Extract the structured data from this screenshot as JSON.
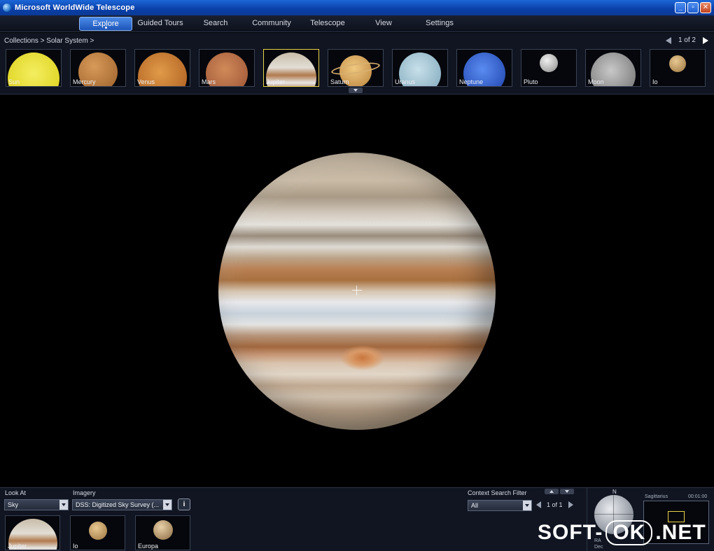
{
  "window": {
    "title": "Microsoft WorldWide Telescope",
    "buttons": {
      "minimize": "_",
      "restore": "▫",
      "close": "✕"
    }
  },
  "nav": {
    "tabs": [
      {
        "label": "Explore",
        "active": true
      },
      {
        "label": "Guided Tours",
        "active": false
      },
      {
        "label": "Search",
        "active": false
      },
      {
        "label": "Community",
        "active": false
      },
      {
        "label": "Telescope",
        "active": false
      },
      {
        "label": "View",
        "active": false
      },
      {
        "label": "Settings",
        "active": false
      }
    ]
  },
  "collections": {
    "breadcrumb": "Collections > Solar System >",
    "pager": "1 of 2",
    "items": [
      {
        "label": "Sun",
        "color": "#e8e01e"
      },
      {
        "label": "Mercury",
        "color": "#b8793a"
      },
      {
        "label": "Venus",
        "color": "#c87a2a"
      },
      {
        "label": "Mars",
        "color": "#b86a3c"
      },
      {
        "label": "Jupiter",
        "color": "#c9b8a0",
        "selected": true
      },
      {
        "label": "Saturn",
        "color": "#d8a860"
      },
      {
        "label": "Uranus",
        "color": "#a8c8d8"
      },
      {
        "label": "Neptune",
        "color": "#2a5ed0"
      },
      {
        "label": "Pluto",
        "color": "#b8b8b8"
      },
      {
        "label": "Moon",
        "color": "#9a9a9a"
      },
      {
        "label": "Io",
        "color": "#c8a878"
      }
    ]
  },
  "bottom": {
    "look_at": {
      "label": "Look At",
      "value": "Sky"
    },
    "imagery": {
      "label": "Imagery",
      "value": "DSS: Digitized Sky Survey (..."
    },
    "info_button": "i",
    "context_filter": {
      "label": "Context Search Filter",
      "value": "All"
    },
    "context_pager": "1 of 1",
    "context_items": [
      {
        "label": "Jupiter",
        "color": "#c9b8a0"
      },
      {
        "label": "Io",
        "color": "#c8a878"
      },
      {
        "label": "Europa",
        "color": "#b89a70"
      }
    ],
    "compass": {
      "north": "N",
      "ra_label": "RA",
      "dec_label": "Dec",
      "constellation": "Sagittarius",
      "time": "00:01:00"
    }
  },
  "watermark": {
    "left": "SOFT-",
    "mid": "OK",
    "right": ".NET"
  },
  "colors": {
    "accent": "#1c54b8",
    "selected_border": "#e8d24a",
    "panel": "#101521"
  }
}
